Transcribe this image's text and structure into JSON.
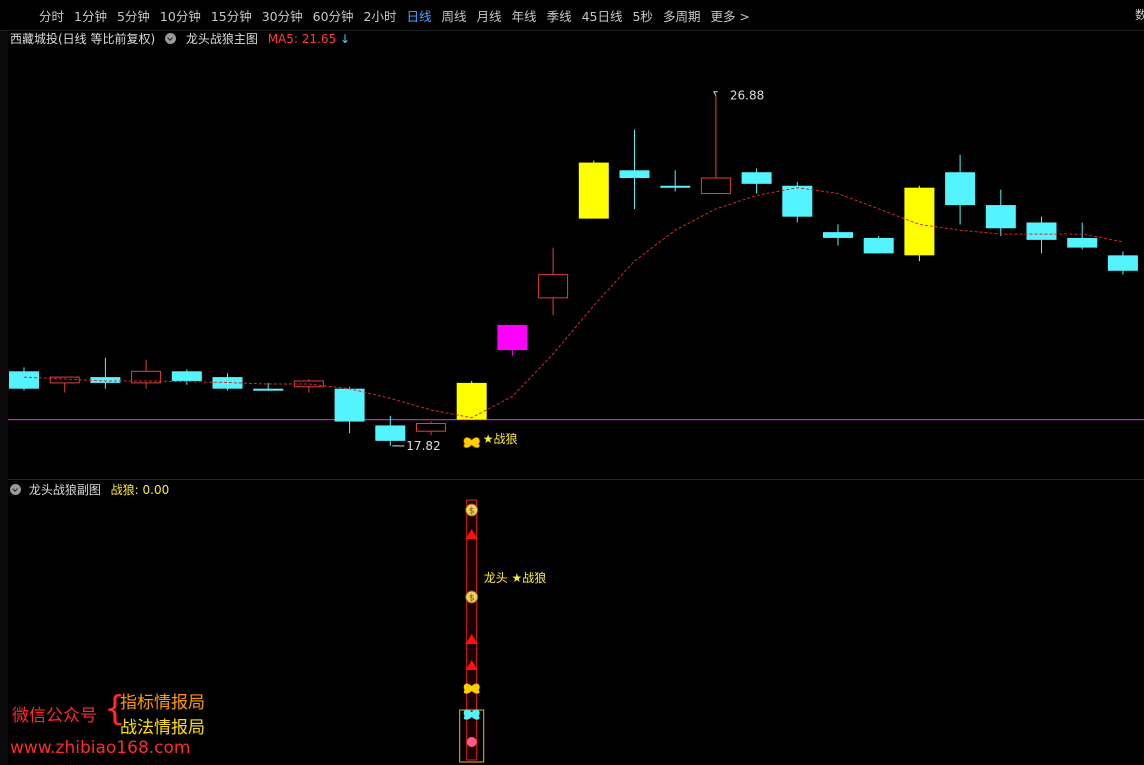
{
  "toolbar": {
    "tabs": [
      "分时",
      "1分钟",
      "5分钟",
      "10分钟",
      "15分钟",
      "30分钟",
      "60分钟",
      "2小时",
      "日线",
      "周线",
      "月线",
      "年线",
      "季线",
      "45日线",
      "5秒",
      "多周期",
      "更多 >"
    ],
    "active_tab": "日线",
    "corner_text": "数"
  },
  "main_header": {
    "stock": "西藏城投(日线 等比前复权)",
    "indicator": "龙头战狼主图",
    "ma_label": "MA5: 21.65",
    "ma_arrow": "↓"
  },
  "sub_header": {
    "indicator": "龙头战狼副图",
    "value_label": "战狼: 0.00"
  },
  "annotations": {
    "high_label": "26.88",
    "low_label": "17.82",
    "signal_main": "★战狼",
    "signal_sub": "龙头 ★战狼"
  },
  "watermark": {
    "wechat": "微信公众号",
    "brace": "{",
    "line1": "指标情报局",
    "line2": "战法情报局",
    "url": "www.zhibiao168.com"
  },
  "colors": {
    "down": "#54f4ff",
    "up": "#e2403a",
    "yellow": "#ffff00",
    "magenta": "#ff00ff",
    "ma_line": "#d42a2a",
    "ref_line": "#c81ec8",
    "bg": "#000000"
  },
  "chart_data": {
    "type": "candlestick",
    "ylim": [
      17.3,
      27.7
    ],
    "reference_line": 18.5,
    "candles": [
      {
        "o": 19.75,
        "h": 19.85,
        "l": 19.25,
        "c": 19.3,
        "color": "down"
      },
      {
        "o": 19.45,
        "h": 19.5,
        "l": 19.2,
        "c": 19.6,
        "color": "up"
      },
      {
        "o": 19.6,
        "h": 20.1,
        "l": 19.3,
        "c": 19.45,
        "color": "down"
      },
      {
        "o": 19.45,
        "h": 20.05,
        "l": 19.3,
        "c": 19.75,
        "color": "up"
      },
      {
        "o": 19.75,
        "h": 19.8,
        "l": 19.4,
        "c": 19.5,
        "color": "down"
      },
      {
        "o": 19.6,
        "h": 19.7,
        "l": 19.25,
        "c": 19.3,
        "color": "down"
      },
      {
        "o": 19.3,
        "h": 19.45,
        "l": 19.25,
        "c": 19.25,
        "color": "down"
      },
      {
        "o": 19.35,
        "h": 19.55,
        "l": 19.2,
        "c": 19.5,
        "color": "up"
      },
      {
        "o": 19.3,
        "h": 19.35,
        "l": 18.15,
        "c": 18.45,
        "color": "down"
      },
      {
        "o": 18.35,
        "h": 18.6,
        "l": 17.82,
        "c": 17.95,
        "color": "down"
      },
      {
        "o": 18.2,
        "h": 18.45,
        "l": 18.1,
        "c": 18.4,
        "color": "up"
      },
      {
        "o": 18.5,
        "h": 19.5,
        "l": 18.5,
        "c": 19.45,
        "color": "yellow"
      },
      {
        "o": 20.3,
        "h": 20.95,
        "l": 20.15,
        "c": 20.95,
        "color": "magenta"
      },
      {
        "o": 21.65,
        "h": 22.95,
        "l": 21.2,
        "c": 22.25,
        "color": "up"
      },
      {
        "o": 23.7,
        "h": 25.2,
        "l": 23.7,
        "c": 25.15,
        "color": "yellow"
      },
      {
        "o": 24.95,
        "h": 26.0,
        "l": 23.95,
        "c": 24.75,
        "color": "down"
      },
      {
        "o": 24.55,
        "h": 24.95,
        "l": 24.4,
        "c": 24.5,
        "color": "down"
      },
      {
        "o": 24.35,
        "h": 26.88,
        "l": 24.35,
        "c": 24.75,
        "color": "up"
      },
      {
        "o": 24.9,
        "h": 25.0,
        "l": 24.35,
        "c": 24.6,
        "color": "down"
      },
      {
        "o": 24.55,
        "h": 24.65,
        "l": 23.6,
        "c": 23.75,
        "color": "down"
      },
      {
        "o": 23.35,
        "h": 23.55,
        "l": 23.0,
        "c": 23.2,
        "color": "down"
      },
      {
        "o": 23.2,
        "h": 23.25,
        "l": 22.8,
        "c": 22.8,
        "color": "down"
      },
      {
        "o": 22.75,
        "h": 24.55,
        "l": 22.6,
        "c": 24.5,
        "color": "yellow"
      },
      {
        "o": 24.9,
        "h": 25.35,
        "l": 23.55,
        "c": 24.05,
        "color": "down"
      },
      {
        "o": 24.05,
        "h": 24.45,
        "l": 23.25,
        "c": 23.45,
        "color": "down"
      },
      {
        "o": 23.6,
        "h": 23.75,
        "l": 22.8,
        "c": 23.15,
        "color": "down"
      },
      {
        "o": 23.2,
        "h": 23.6,
        "l": 22.9,
        "c": 22.95,
        "color": "down"
      },
      {
        "o": 22.75,
        "h": 22.85,
        "l": 22.25,
        "c": 22.35,
        "color": "down"
      }
    ],
    "ma5": [
      19.6,
      19.55,
      19.5,
      19.5,
      19.48,
      19.46,
      19.42,
      19.42,
      19.3,
      19.05,
      18.75,
      18.55,
      19.1,
      20.2,
      21.45,
      22.6,
      23.4,
      23.95,
      24.3,
      24.5,
      24.35,
      23.95,
      23.55,
      23.4,
      23.3,
      23.3,
      23.3,
      23.1
    ]
  }
}
